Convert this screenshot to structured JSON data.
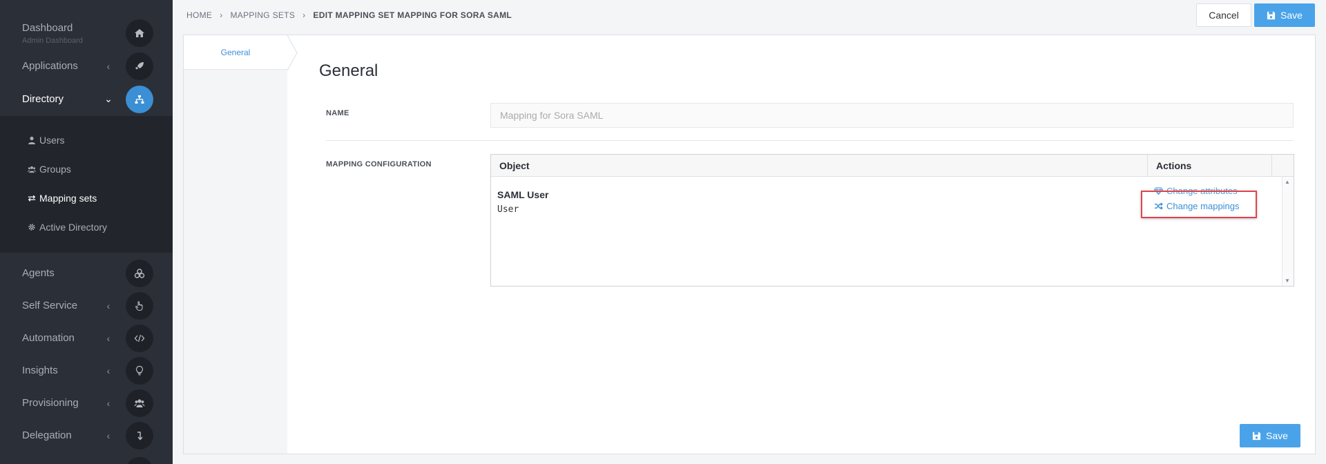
{
  "sidebar": {
    "dashboard": {
      "label": "Dashboard",
      "sub": "Admin Dashboard",
      "icon": "home-icon"
    },
    "applications": {
      "label": "Applications",
      "icon": "rocket-icon"
    },
    "directory": {
      "label": "Directory",
      "icon": "sitemap-icon",
      "children": [
        {
          "label": "Users",
          "icon": "user-icon"
        },
        {
          "label": "Groups",
          "icon": "users-icon"
        },
        {
          "label": "Mapping sets",
          "icon": "exchange-icon"
        },
        {
          "label": "Active Directory",
          "icon": "gear-icon"
        }
      ]
    },
    "agents": {
      "label": "Agents",
      "icon": "cubes-icon"
    },
    "self_service": {
      "label": "Self Service",
      "icon": "hand-pointer-icon"
    },
    "automation": {
      "label": "Automation",
      "icon": "code-icon"
    },
    "insights": {
      "label": "Insights",
      "icon": "lightbulb-icon"
    },
    "provisioning": {
      "label": "Provisioning",
      "icon": "users-icon"
    },
    "delegation": {
      "label": "Delegation",
      "icon": "level-down-icon"
    }
  },
  "breadcrumb": {
    "home": "HOME",
    "mapping_sets": "MAPPING SETS",
    "current": "EDIT MAPPING SET MAPPING FOR SORA SAML"
  },
  "toolbar": {
    "cancel_label": "Cancel",
    "save_label": "Save"
  },
  "tabs": {
    "general": "General"
  },
  "form": {
    "section_title": "General",
    "name_label": "NAME",
    "name_value": "Mapping for Sora SAML",
    "mapping_label": "MAPPING CONFIGURATION"
  },
  "grid": {
    "columns": [
      "Object",
      "Actions"
    ],
    "rows": [
      {
        "title": "SAML User",
        "subtitle": "User",
        "actions": [
          "Change attributes",
          "Change mappings"
        ]
      }
    ]
  },
  "colors": {
    "accent": "#4aa3e8",
    "sidebar": "#2b2f37",
    "highlight": "#e0424b"
  }
}
